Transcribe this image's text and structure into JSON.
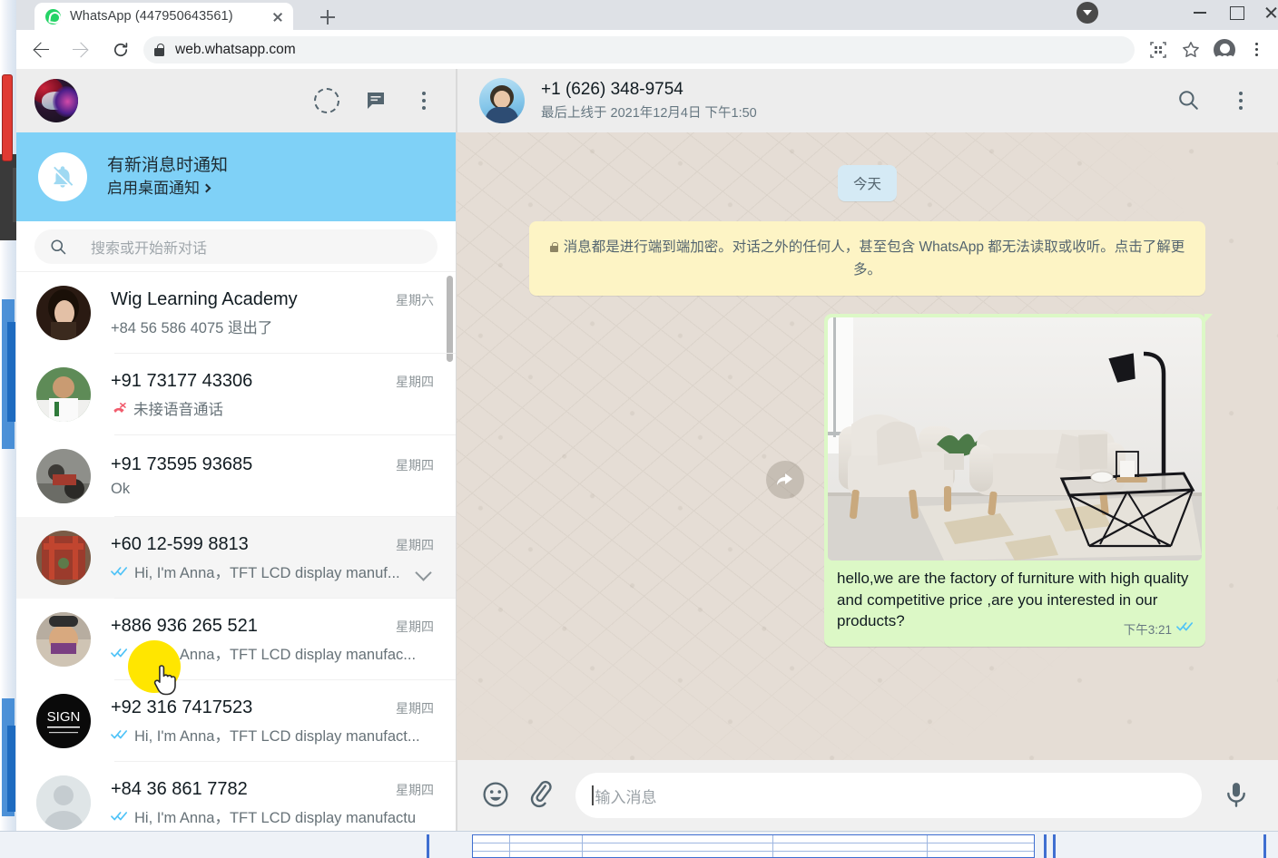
{
  "browser": {
    "tab": {
      "title": "WhatsApp  (447950643561)",
      "favicon": "whatsapp-favicon",
      "close": "×"
    },
    "new_tab_label": "+",
    "url": "web.whatsapp.com",
    "icons": {
      "back": "back-arrow-icon",
      "forward": "forward-arrow-icon",
      "reload": "reload-icon",
      "lock": "lock-icon",
      "qr": "qr-code-icon",
      "star": "bookmark-star-icon",
      "profile": "profile-avatar-icon",
      "menu": "chrome-menu-icon"
    },
    "window": {
      "minimize": "minimize-icon",
      "maximize": "maximize-icon",
      "close": "close-icon"
    }
  },
  "sidebar": {
    "header": {
      "avatar": "my-profile-avatar",
      "status_icon": "status-ring-icon",
      "newchat_icon": "new-chat-icon",
      "menu_icon": "sidebar-menu-icon"
    },
    "notification": {
      "icon": "bell-off-icon",
      "title": "有新消息时通知",
      "subtitle": "启用桌面通知"
    },
    "search": {
      "icon": "search-icon",
      "placeholder": "搜索或开始新对话",
      "value": ""
    },
    "chats": [
      {
        "name": "Wig Learning Academy",
        "time": "星期六",
        "preview": "+84 56 586 4075 退出了",
        "ticks": "none",
        "active": false,
        "chevron": false
      },
      {
        "name": "+91 73177 43306",
        "time": "星期四",
        "preview": "未接语音通话",
        "ticks": "missed-call",
        "active": false,
        "chevron": false
      },
      {
        "name": "+91 73595 93685",
        "time": "星期四",
        "preview": "Ok",
        "ticks": "none",
        "active": false,
        "chevron": false
      },
      {
        "name": "+60 12-599 8813",
        "time": "星期四",
        "preview": "Hi, I'm Anna，TFT LCD display manuf...",
        "ticks": "read",
        "active": true,
        "chevron": true
      },
      {
        "name": "+886 936 265 521",
        "time": "星期四",
        "preview": "Hi, I'm Anna，TFT LCD display manufac...",
        "ticks": "read",
        "active": false,
        "chevron": false
      },
      {
        "name": "+92 316 7417523",
        "time": "星期四",
        "preview": "Hi, I'm Anna，TFT LCD display manufact...",
        "ticks": "read",
        "active": false,
        "chevron": false
      },
      {
        "name": "+84 36 861 7782",
        "time": "星期四",
        "preview": "Hi, I'm Anna，TFT LCD display manufactu",
        "ticks": "read",
        "active": false,
        "chevron": false
      }
    ]
  },
  "chat": {
    "header": {
      "avatar": "contact-avatar",
      "name": "+1 (626) 348-9754",
      "status": "最后上线于 2021年12月4日 下午1:50",
      "search_icon": "search-icon",
      "menu_icon": "chat-menu-icon"
    },
    "day_divider": "今天",
    "encryption_notice": "消息都是进行端到端加密。对话之外的任何人，甚至包含 WhatsApp 都无法读取或收听。点击了解更多。",
    "messages": [
      {
        "direction": "out",
        "attachment": "living-room-furniture-photo",
        "text": "hello,we are the factory of furniture with high quality and competitive price ,are you interested in our products?",
        "time": "下午3:21",
        "ticks": "read",
        "forward_icon": "forward-message-icon"
      }
    ],
    "composer": {
      "emoji_icon": "emoji-smiley-icon",
      "attach_icon": "paperclip-icon",
      "placeholder": "输入消息",
      "value": "",
      "mic_icon": "microphone-icon"
    }
  },
  "colors": {
    "brand_green": "#25D366",
    "bubble_out": "#dcf8c6",
    "chat_bg": "#e5ddd5",
    "notice_yellow": "#fdf4c5",
    "banner_blue": "#7fd1f7",
    "tick_blue": "#4fc3f7"
  }
}
